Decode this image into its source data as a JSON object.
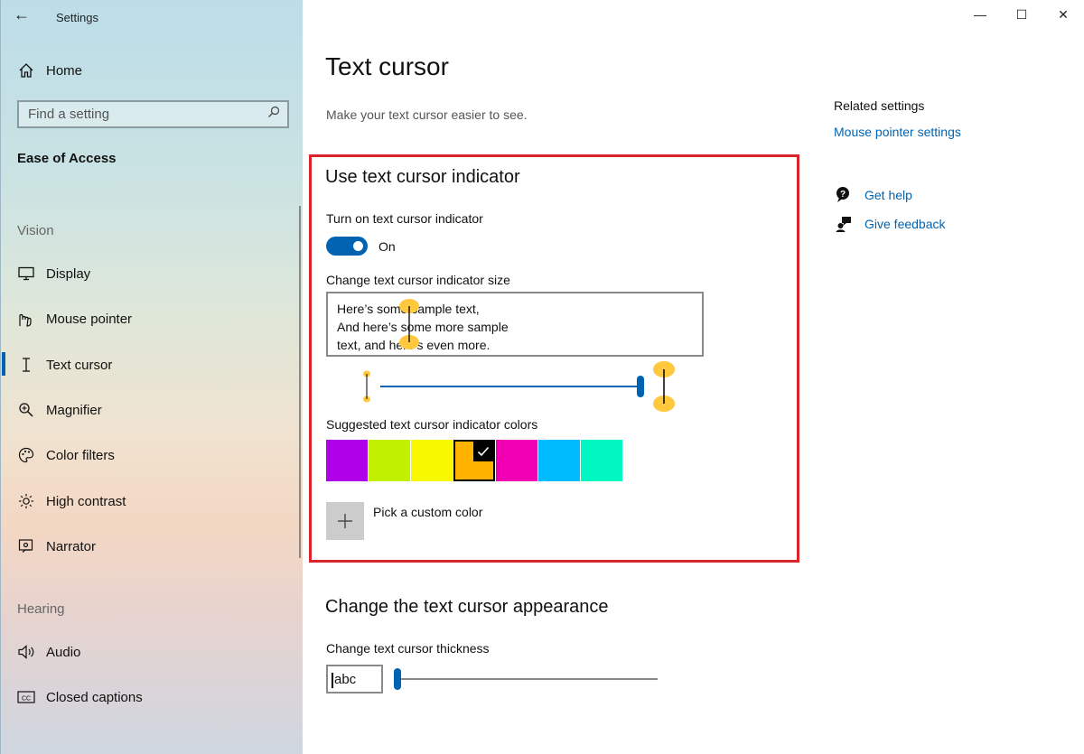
{
  "window": {
    "app_title": "Settings",
    "back_glyph": "←",
    "minimize_glyph": "—",
    "maximize_glyph": "☐",
    "close_glyph": "✕"
  },
  "sidebar": {
    "home_label": "Home",
    "search_placeholder": "Find a setting",
    "section_heading": "Ease of Access",
    "groups": {
      "vision": "Vision",
      "hearing": "Hearing"
    },
    "items": [
      {
        "label": "Display",
        "icon": "display-icon"
      },
      {
        "label": "Mouse pointer",
        "icon": "mouse-pointer-icon"
      },
      {
        "label": "Text cursor",
        "icon": "text-cursor-icon",
        "active": true
      },
      {
        "label": "Magnifier",
        "icon": "magnifier-icon"
      },
      {
        "label": "Color filters",
        "icon": "color-filters-icon"
      },
      {
        "label": "High contrast",
        "icon": "high-contrast-icon"
      },
      {
        "label": "Narrator",
        "icon": "narrator-icon"
      },
      {
        "label": "Audio",
        "icon": "audio-icon"
      },
      {
        "label": "Closed captions",
        "icon": "closed-captions-icon"
      }
    ]
  },
  "main": {
    "title": "Text cursor",
    "description": "Make your text cursor easier to see.",
    "indicator_section": {
      "title": "Use text cursor indicator",
      "toggle_label": "Turn on text cursor indicator",
      "toggle_state": "On",
      "toggle_on": true,
      "size_label": "Change text cursor indicator size",
      "sample_lines": [
        "Here’s some sample text,",
        "And here’s some more sample",
        "text, and here’s even more."
      ],
      "size_slider_value": 1.0,
      "colors_label": "Suggested text cursor indicator colors",
      "colors": [
        "#b000ea",
        "#c1f000",
        "#f8f800",
        "#ffb300",
        "#f100b3",
        "#00bcff",
        "#00f7c1"
      ],
      "selected_color_index": 3,
      "custom_color_label": "Pick a custom color"
    },
    "appearance_section": {
      "title": "Change the text cursor appearance",
      "thickness_label": "Change text cursor thickness",
      "preview_text": "abc",
      "thickness_slider_value": 0.0
    }
  },
  "related": {
    "heading": "Related settings",
    "link": "Mouse pointer settings",
    "help": "Get help",
    "feedback": "Give feedback"
  },
  "colors": {
    "accent": "#0063b1",
    "highlight_border": "#d9242c",
    "indicator_yellow": "#ffc83d"
  }
}
